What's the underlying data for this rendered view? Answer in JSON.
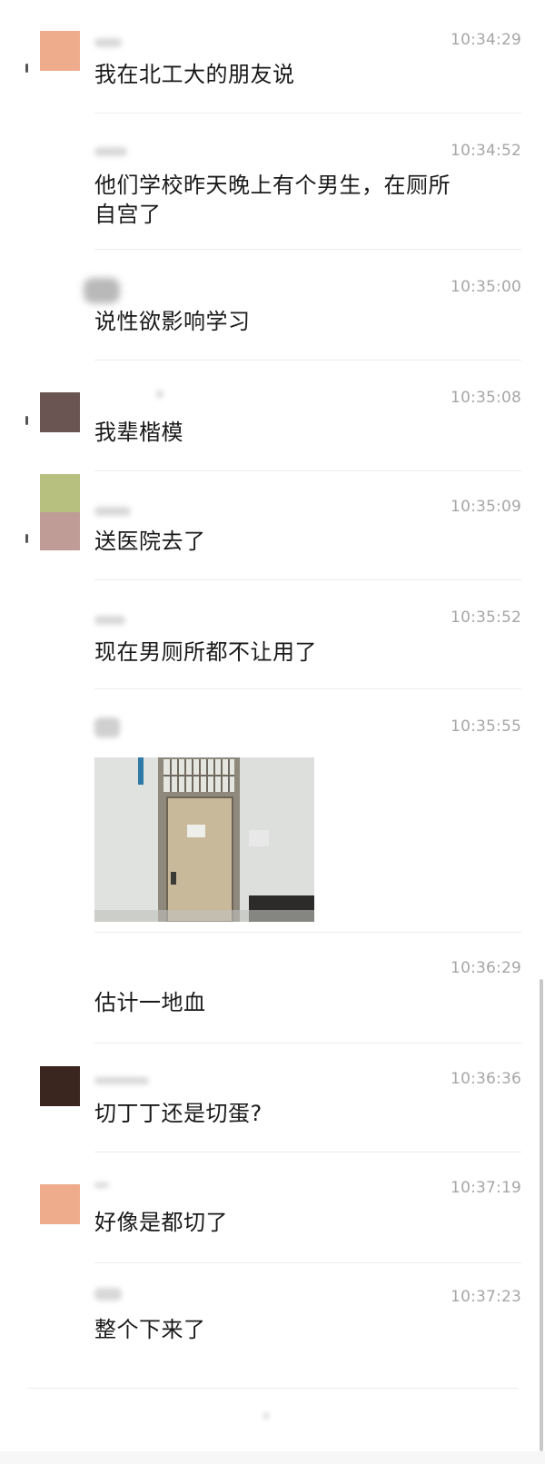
{
  "messages": [
    {
      "id": "m1",
      "time": "10:34:29",
      "text": "我在北工大的朋友说",
      "avatar": "peach"
    },
    {
      "id": "m2",
      "time": "10:34:52",
      "text": "他们学校昨天晚上有个男生，在厕所自宫了",
      "text_line1": "他们学校昨天晚上有个男生，在厕所",
      "text_line2": "自宫了",
      "avatar": ""
    },
    {
      "id": "m3",
      "time": "10:35:00",
      "text": "说性欲影响学习",
      "avatar": ""
    },
    {
      "id": "m4",
      "time": "10:35:08",
      "text": "我辈楷模",
      "avatar": "brown"
    },
    {
      "id": "m5",
      "time": "10:35:09",
      "text": "送医院去了",
      "avatar": "green-pink"
    },
    {
      "id": "m6",
      "time": "10:35:52",
      "text": "现在男厕所都不让用了",
      "avatar": ""
    },
    {
      "id": "m7",
      "time": "10:35:55",
      "text": "",
      "avatar": "",
      "image": "restroom-door-photo"
    },
    {
      "id": "m8",
      "time": "10:36:29",
      "text": "估计一地血",
      "avatar": ""
    },
    {
      "id": "m9",
      "time": "10:36:36",
      "text": "切丁丁还是切蛋?",
      "avatar": "dark-brown"
    },
    {
      "id": "m10",
      "time": "10:37:19",
      "text": "好像是都切了",
      "avatar": "peach"
    },
    {
      "id": "m11",
      "time": "10:37:23",
      "text": "整个下来了",
      "avatar": ""
    }
  ],
  "colors": {
    "peach": "#efac8c",
    "brown": "#6b5552",
    "green": "#b7c07f",
    "pink": "#bf9d96",
    "dark_brown": "#3a261f",
    "time_gray": "#a6a6a6",
    "divider": "#ececec"
  }
}
